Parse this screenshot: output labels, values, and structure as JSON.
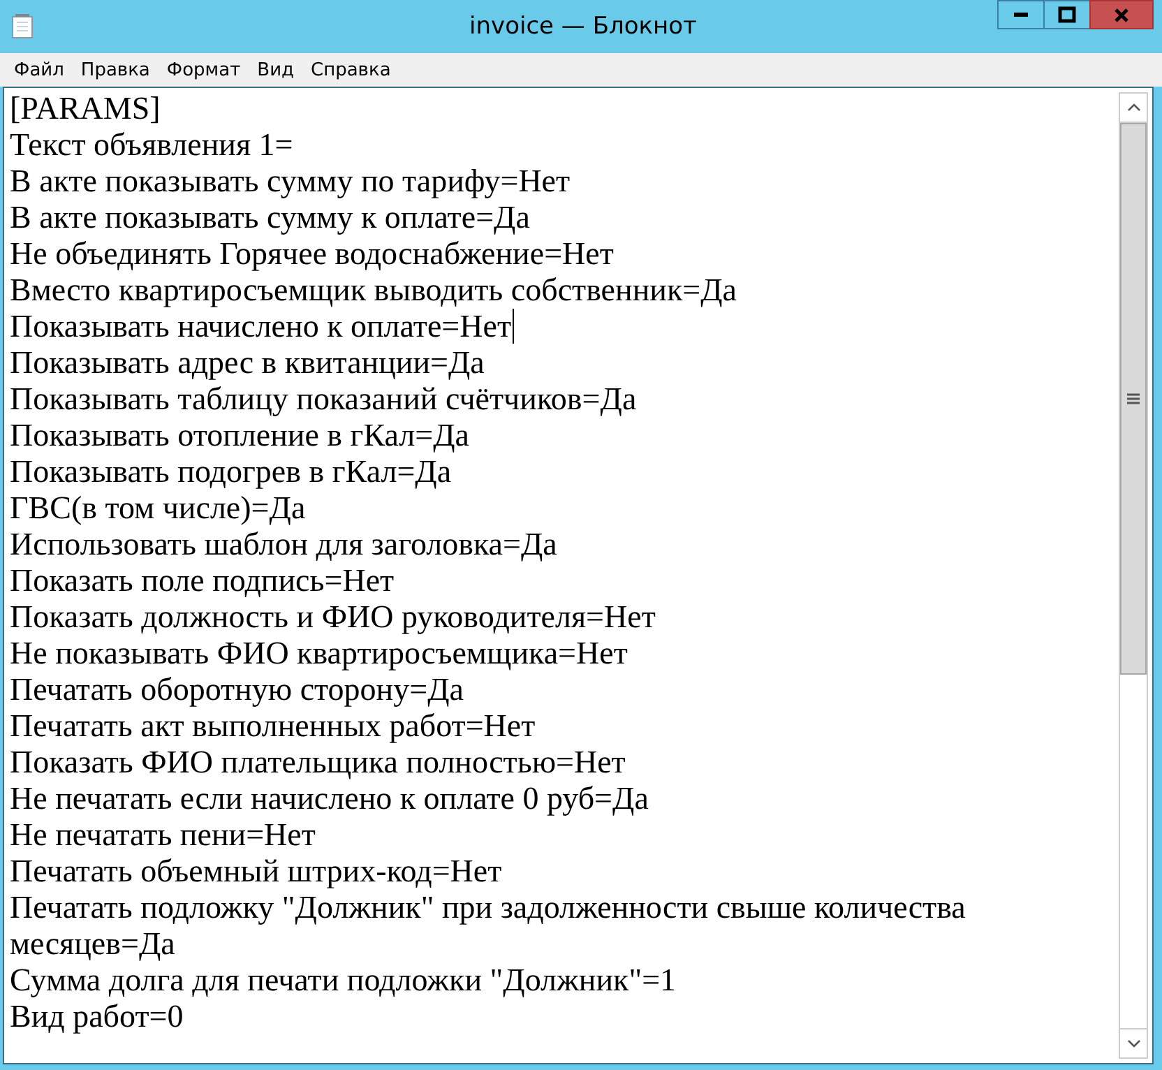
{
  "window": {
    "title": "invoice — Блокнот"
  },
  "menu": [
    {
      "label": "Файл"
    },
    {
      "label": "Правка"
    },
    {
      "label": "Формат"
    },
    {
      "label": "Вид"
    },
    {
      "label": "Справка"
    }
  ],
  "lines": [
    {
      "text": "[PARAMS]",
      "caret": false
    },
    {
      "text": "Текст объявления 1=",
      "caret": false
    },
    {
      "text": "В акте показывать сумму по тарифу=Нет",
      "caret": false
    },
    {
      "text": "В акте показывать сумму к оплате=Да",
      "caret": false
    },
    {
      "text": "Не объединять Горячее водоснабжение=Нет",
      "caret": false
    },
    {
      "text": "Вместо квартиросъемщик выводить собственник=Да",
      "caret": false
    },
    {
      "text": "Показывать начислено к оплате=Нет",
      "caret": true
    },
    {
      "text": "Показывать адрес в квитанции=Да",
      "caret": false
    },
    {
      "text": "Показывать таблицу показаний счётчиков=Да",
      "caret": false
    },
    {
      "text": "Показывать отопление в гКал=Да",
      "caret": false
    },
    {
      "text": "Показывать подогрев в гКал=Да",
      "caret": false
    },
    {
      "text": "ГВС(в том числе)=Да",
      "caret": false
    },
    {
      "text": "Использовать шаблон для заголовка=Да",
      "caret": false
    },
    {
      "text": "Показать поле подпись=Нет",
      "caret": false
    },
    {
      "text": "Показать должность и ФИО руководителя=Нет",
      "caret": false
    },
    {
      "text": "Не показывать ФИО квартиросъемщика=Нет",
      "caret": false
    },
    {
      "text": "Печатать оборотную сторону=Да",
      "caret": false
    },
    {
      "text": "Печатать акт выполненных работ=Нет",
      "caret": false
    },
    {
      "text": "Показать ФИО плательщика полностью=Нет",
      "caret": false
    },
    {
      "text": "Не печатать если начислено к оплате 0 руб=Да",
      "caret": false
    },
    {
      "text": "Не печатать пени=Нет",
      "caret": false
    },
    {
      "text": "Печатать объемный штрих-код=Нет",
      "caret": false
    },
    {
      "text": "Печатать подложку \"Должник\" при задолженности свыше количества месяцев=Да",
      "caret": false
    },
    {
      "text": "Сумма долга для печати подложки \"Должник\"=1",
      "caret": false
    },
    {
      "text": "Вид работ=0",
      "caret": false
    }
  ]
}
